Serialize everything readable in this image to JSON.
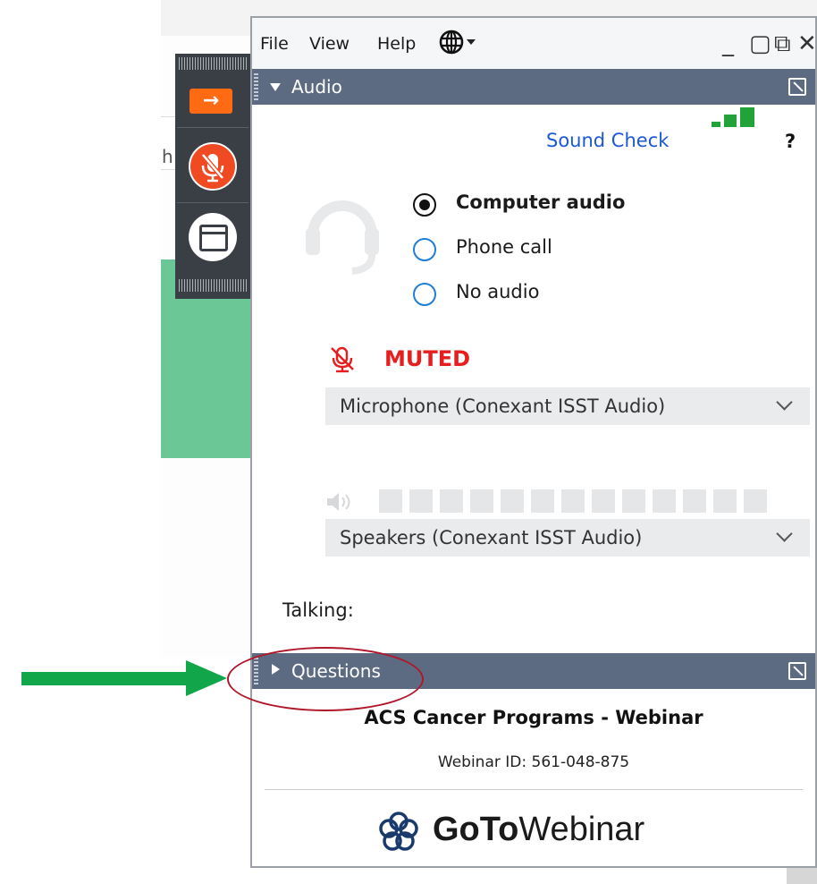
{
  "background": {
    "partial_letter": "h"
  },
  "toolbar": {
    "show_button_glyph": "→",
    "colors": {
      "accent": "#ff6a12",
      "mute": "#f04a23",
      "body": "#3a3f45"
    }
  },
  "menubar": {
    "items": [
      "File",
      "View",
      "Help"
    ],
    "language_icon": "globe-icon",
    "window_controls": [
      "_",
      "▢",
      "⧉",
      "✕"
    ]
  },
  "audio": {
    "header": "Audio",
    "sound_check": "Sound Check",
    "sound_check_level": {
      "filled": 3,
      "total": 3
    },
    "help": "?",
    "options": [
      {
        "label": "Computer audio",
        "selected": true
      },
      {
        "label": "Phone call",
        "selected": false
      },
      {
        "label": "No audio",
        "selected": false
      }
    ],
    "status": "MUTED",
    "microphone": "Microphone (Conexant ISST Audio)",
    "speaker_level": {
      "filled": 0,
      "total": 13
    },
    "speakers": "Speakers (Conexant ISST Audio)",
    "talking_label": "Talking:"
  },
  "questions": {
    "header": "Questions"
  },
  "webinar": {
    "title": "ACS Cancer Programs - Webinar",
    "id_text": "Webinar ID: 561-048-875",
    "logo_bold": "GoTo",
    "logo_regular": "Webinar"
  },
  "colors": {
    "section_header": "#5d6b82",
    "link": "#1a58d4",
    "muted": "#e61e1e",
    "meter": "#22a33a",
    "annotation_arrow": "#12a64a",
    "annotation_circle": "#b0172a"
  }
}
